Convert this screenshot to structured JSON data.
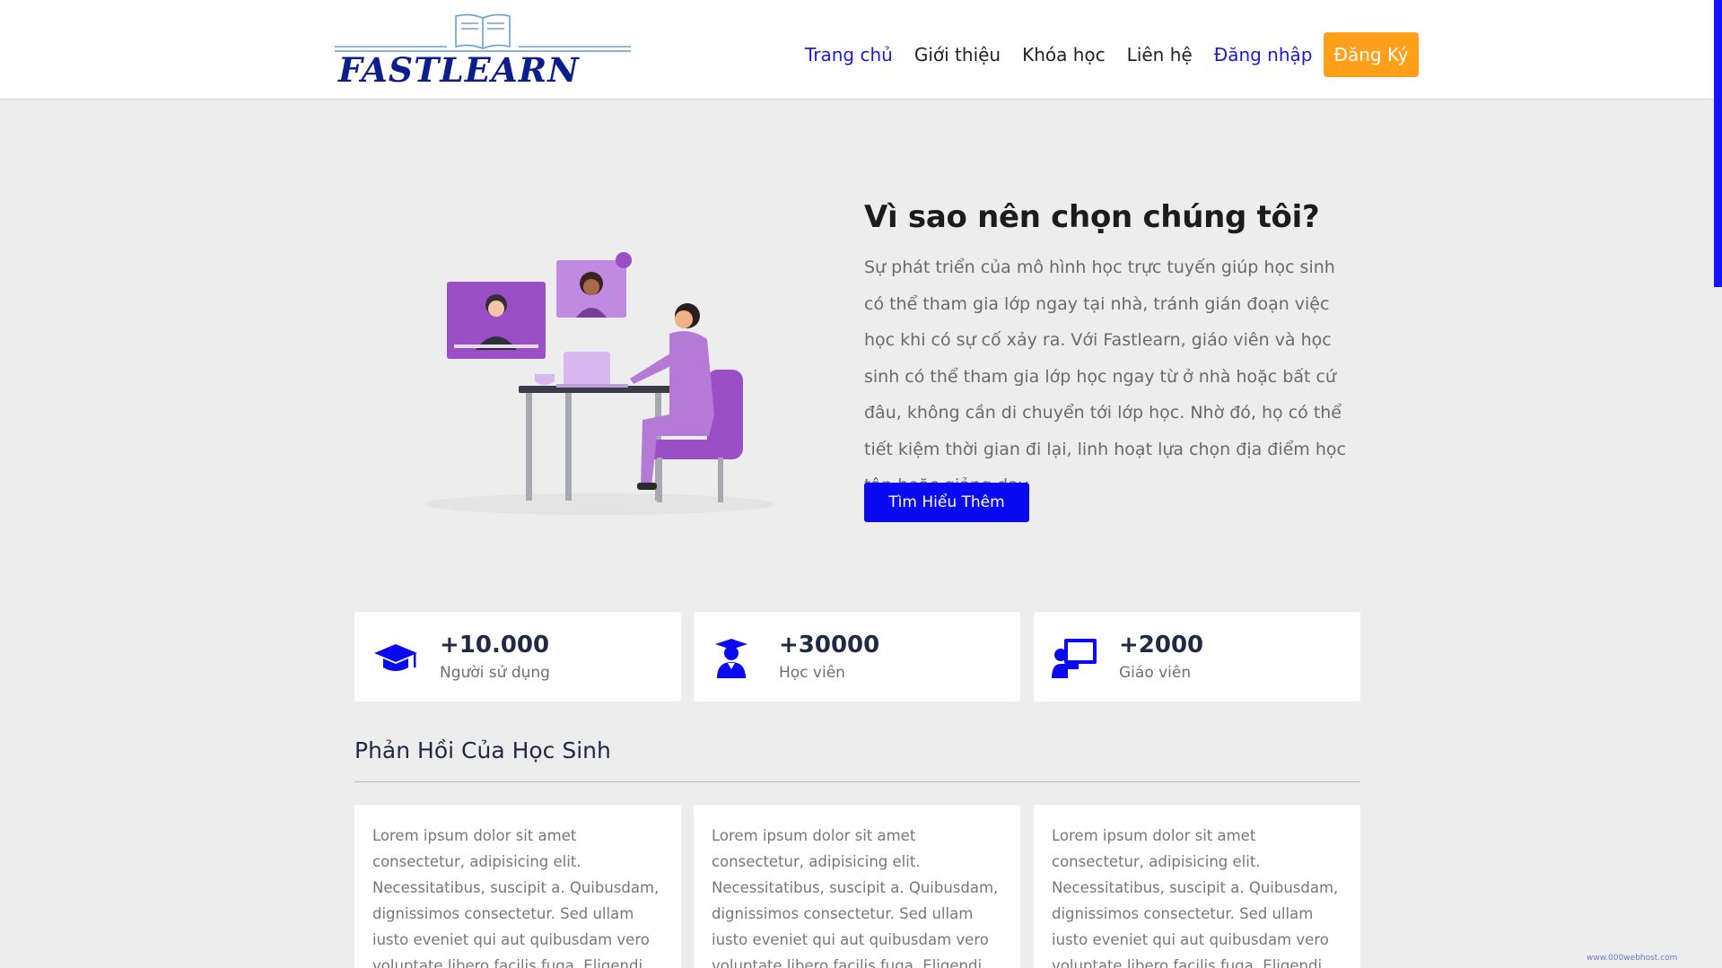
{
  "header": {
    "logo_text": "FASTLEARN",
    "nav": [
      {
        "label": "Trang chủ"
      },
      {
        "label": "Giới thiệu"
      },
      {
        "label": "Khóa học"
      },
      {
        "label": "Liên hệ"
      },
      {
        "label": "Đăng nhập"
      }
    ],
    "signup_label": "Đăng Ký"
  },
  "hero": {
    "title": "Vì sao nên chọn chúng tôi?",
    "text": "Sự phát triển của mô hình học trực tuyến giúp học sinh có thể tham gia lớp ngay tại nhà, tránh gián đoạn việc học khi có sự cố xảy ra. Với Fastlearn, giáo viên và học sinh có thể tham gia lớp học ngay từ ở nhà hoặc bất cứ đâu, không cần di chuyển tới lớp học. Nhờ đó, họ có thể tiết kiệm thời gian đi lại, linh hoạt lựa chọn địa điểm học tập hoặc giảng dạy.",
    "button_label": "Tìm Hiểu Thêm"
  },
  "stats": [
    {
      "icon": "graduation-cap-icon",
      "value": "+10.000",
      "label": "Người sử dụng"
    },
    {
      "icon": "student-icon",
      "value": "+30000",
      "label": "Học viên"
    },
    {
      "icon": "teacher-icon",
      "value": "+2000",
      "label": "Giáo viên"
    }
  ],
  "feedback": {
    "title": "Phản Hồi Của Học Sinh",
    "items": [
      {
        "text": "Lorem ipsum dolor sit amet consectetur, adipisicing elit. Necessitatibus, suscipit a. Quibusdam, dignissimos consectetur. Sed ullam iusto eveniet qui aut quibusdam vero voluptate libero facilis fuga. Eligendi eaque molestiae modi?"
      },
      {
        "text": "Lorem ipsum dolor sit amet consectetur, adipisicing elit. Necessitatibus, suscipit a. Quibusdam, dignissimos consectetur. Sed ullam iusto eveniet qui aut quibusdam vero voluptate libero facilis fuga. Eligendi eaque molestiae modi?"
      },
      {
        "text": "Lorem ipsum dolor sit amet consectetur, adipisicing elit. Necessitatibus, suscipit a. Quibusdam, dignissimos consectetur. Sed ullam iusto eveniet qui aut quibusdam vero voluptate libero facilis fuga. Eligendi eaque molestiae modi?"
      }
    ]
  },
  "badge_text": "www.000webhost.com",
  "colors": {
    "primary": "#0a0af0",
    "accent": "#ff9f1a",
    "nav_active": "#1b1bd6",
    "illustration": "#9b4fc4"
  }
}
